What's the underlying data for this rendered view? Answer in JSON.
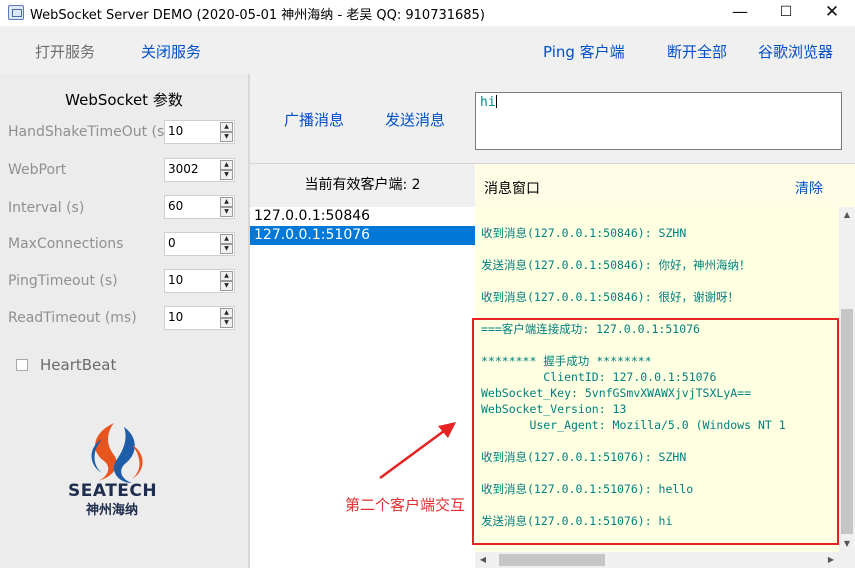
{
  "window": {
    "title": "WebSocket Server DEMO (2020-05-01 神州海纳 - 老吴 QQ: 910731685)",
    "minimize": "—",
    "maximize": "☐",
    "close": "✕"
  },
  "toolbar": {
    "open_service": "打开服务",
    "close_service": "关闭服务",
    "ping_client": "Ping 客户端",
    "disconnect_all": "断开全部",
    "google_browser": "谷歌浏览器"
  },
  "params": {
    "title": "WebSocket 参数",
    "items": [
      {
        "label": "HandShakeTimeOut  (s)",
        "value": "10"
      },
      {
        "label": "WebPort",
        "value": "3002"
      },
      {
        "label": "Interval  (s)",
        "value": "60"
      },
      {
        "label": "MaxConnections",
        "value": "0"
      },
      {
        "label": "PingTimeout  (s)",
        "value": "10"
      },
      {
        "label": "ReadTimeout  (ms)",
        "value": "10"
      }
    ],
    "heartbeat": "HeartBeat"
  },
  "logo": {
    "name": "SEATECH",
    "cn": "神州海纳"
  },
  "actions": {
    "broadcast": "广播消息",
    "send": "发送消息",
    "input_value": "hi"
  },
  "clients": {
    "header": "当前有效客户端: 2",
    "items": [
      "127.0.0.1:50846",
      "127.0.0.1:51076"
    ],
    "selected_index": 1
  },
  "message_window": {
    "title": "消息窗口",
    "clear": "清除",
    "lines": [
      "收到消息(127.0.0.1:50846): SZHN",
      "发送消息(127.0.0.1:50846): 你好，神州海纳！",
      "收到消息(127.0.0.1:50846): 很好，谢谢呀！",
      "===客户端连接成功: 127.0.0.1:51076",
      "******** 握手成功 ********",
      "         ClientID: 127.0.0.1:51076",
      "WebSocket_Key: 5vnfGSmvXWAWXjvjTSXLyA==",
      "WebSocket_Version: 13",
      "       User_Agent: Mozilla/5.0 (Windows NT 1",
      "收到消息(127.0.0.1:51076): SZHN",
      "收到消息(127.0.0.1:51076): hello",
      "发送消息(127.0.0.1:51076): hi"
    ]
  },
  "annotation": "第二个客户端交互",
  "colors": {
    "link": "#0050c8",
    "message_text": "#008080",
    "highlight_box": "#e62222",
    "selection": "#0078d7"
  }
}
